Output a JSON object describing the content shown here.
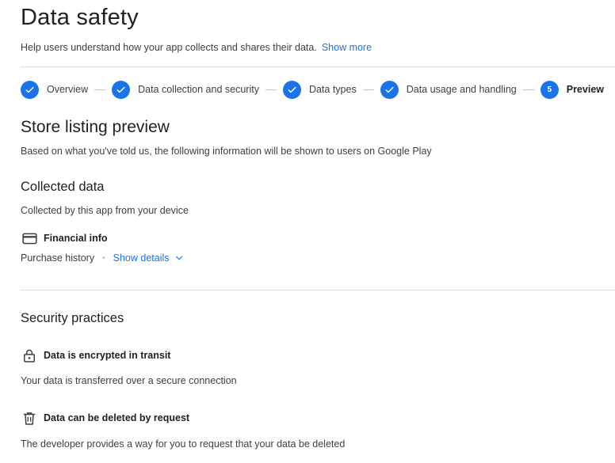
{
  "page": {
    "title": "Data safety",
    "subtitle": "Help users understand how your app collects and shares their data.",
    "show_more": "Show more"
  },
  "stepper": {
    "steps": [
      {
        "label": "Overview",
        "state": "complete"
      },
      {
        "label": "Data collection and security",
        "state": "complete"
      },
      {
        "label": "Data types",
        "state": "complete"
      },
      {
        "label": "Data usage and handling",
        "state": "complete"
      },
      {
        "label": "Preview",
        "number": "5",
        "state": "active"
      }
    ]
  },
  "preview": {
    "heading": "Store listing preview",
    "description": "Based on what you've told us, the following information will be shown to users on Google Play"
  },
  "collected": {
    "heading": "Collected data",
    "description": "Collected by this app from your device",
    "category": {
      "icon": "credit-card-icon",
      "label": "Financial info"
    },
    "types": "Purchase history",
    "show_details": "Show details"
  },
  "security": {
    "heading": "Security practices",
    "items": [
      {
        "icon": "lock-icon",
        "label": "Data is encrypted in transit",
        "description": "Your data is transferred over a secure connection"
      },
      {
        "icon": "trash-icon",
        "label": "Data can be deleted by request",
        "description": "The developer provides a way for you to request that your data be deleted"
      }
    ]
  },
  "colors": {
    "accent": "#1a73e8",
    "text": "#202124",
    "secondary_text": "#3c4043",
    "divider": "#dadce0"
  }
}
